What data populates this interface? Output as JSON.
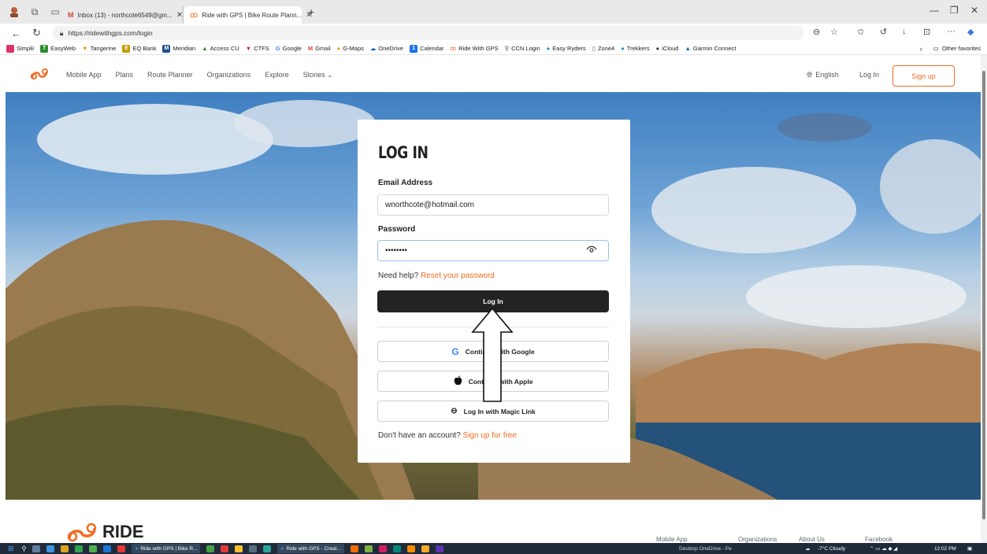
{
  "browser": {
    "tabs": [
      {
        "label": "Inbox (13) - northcote6549@gm..."
      },
      {
        "label": "Ride with GPS | Bike Route Plann..."
      }
    ],
    "url": "https://ridewithgps.com/login",
    "favorites": [
      "Simplii",
      "EasyWeb",
      "Tangerine",
      "EQ Bank",
      "Meridian",
      "Access CU",
      "CTFS",
      "Google",
      "Gmail",
      "G-Maps",
      "OneDrive",
      "Calendar",
      "Ride With GPS",
      "CCN Login",
      "Easy Ryders",
      "Zone4",
      "Trekkers",
      "iCloud",
      "Garmin Connect"
    ],
    "other_favorites": "Other favorites"
  },
  "nav": {
    "links": [
      "Mobile App",
      "Plans",
      "Route Planner",
      "Organizations",
      "Explore",
      "Stories"
    ],
    "language": "English",
    "login": "Log In",
    "signup": "Sign up"
  },
  "login": {
    "title": "LOG IN",
    "email_label": "Email Address",
    "email_value": "wnorthcote@hotmail.com",
    "password_label": "Password",
    "password_value": "••••••••",
    "help_text": "Need help?",
    "reset_link": "Reset your password",
    "login_button": "Log In",
    "google_button": "Continue with Google",
    "apple_button": "Continue with Apple",
    "magic_button": "Log In with Magic Link",
    "no_account_text": "Don't have an account?",
    "signup_link": "Sign up for free"
  },
  "footer": {
    "logo": "RIDE",
    "links": [
      "Mobile App",
      "Organizations",
      "About Us",
      "Facebook"
    ]
  },
  "taskbar": {
    "apps": [
      "Ride with GPS | Bike R...",
      "Ride with GPS - Creat..."
    ],
    "onedrive": "Desktop  OneDrive - Pe",
    "weather": "-7°C  Cloudy",
    "time": "12:02 PM"
  },
  "colors": {
    "accent": "#f26b21",
    "button_dark": "#232323"
  }
}
